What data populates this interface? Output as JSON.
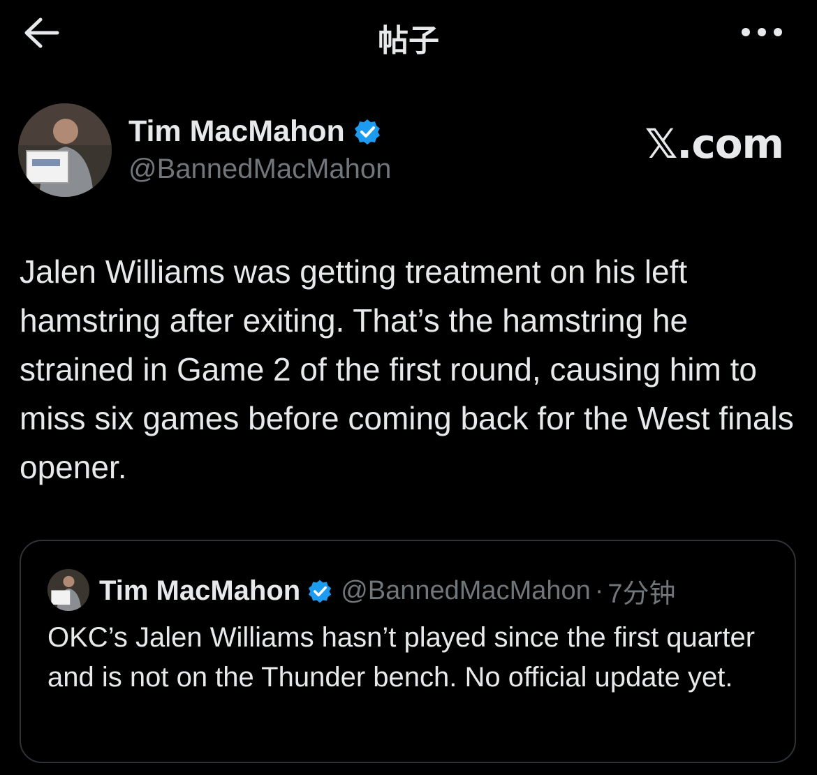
{
  "header": {
    "title": "帖子",
    "back_icon": "arrow-left-icon",
    "more_icon": "more-horizontal-icon"
  },
  "tweet": {
    "author_name": "Tim MacMahon",
    "author_handle": "@BannedMacMahon",
    "verified": true,
    "brand": "𝕏.com",
    "text": "Jalen Williams was getting treatment on his left hamstring after exiting. That’s the hamstring he strained in Game 2 of the first round, causing him to miss six games before coming back for the West finals opener."
  },
  "quoted_tweet": {
    "author_name": "Tim MacMahon",
    "author_handle": "@BannedMacMahon",
    "separator": "·",
    "time": "7分钟",
    "verified": true,
    "text": "OKC’s Jalen Williams hasn’t played since the first quarter and is not on the Thunder bench. No official update yet."
  },
  "colors": {
    "background": "#000000",
    "text_primary": "#e7e9ea",
    "text_secondary": "#71767b",
    "verified_blue": "#1d9bf0",
    "border": "#2f3336"
  }
}
